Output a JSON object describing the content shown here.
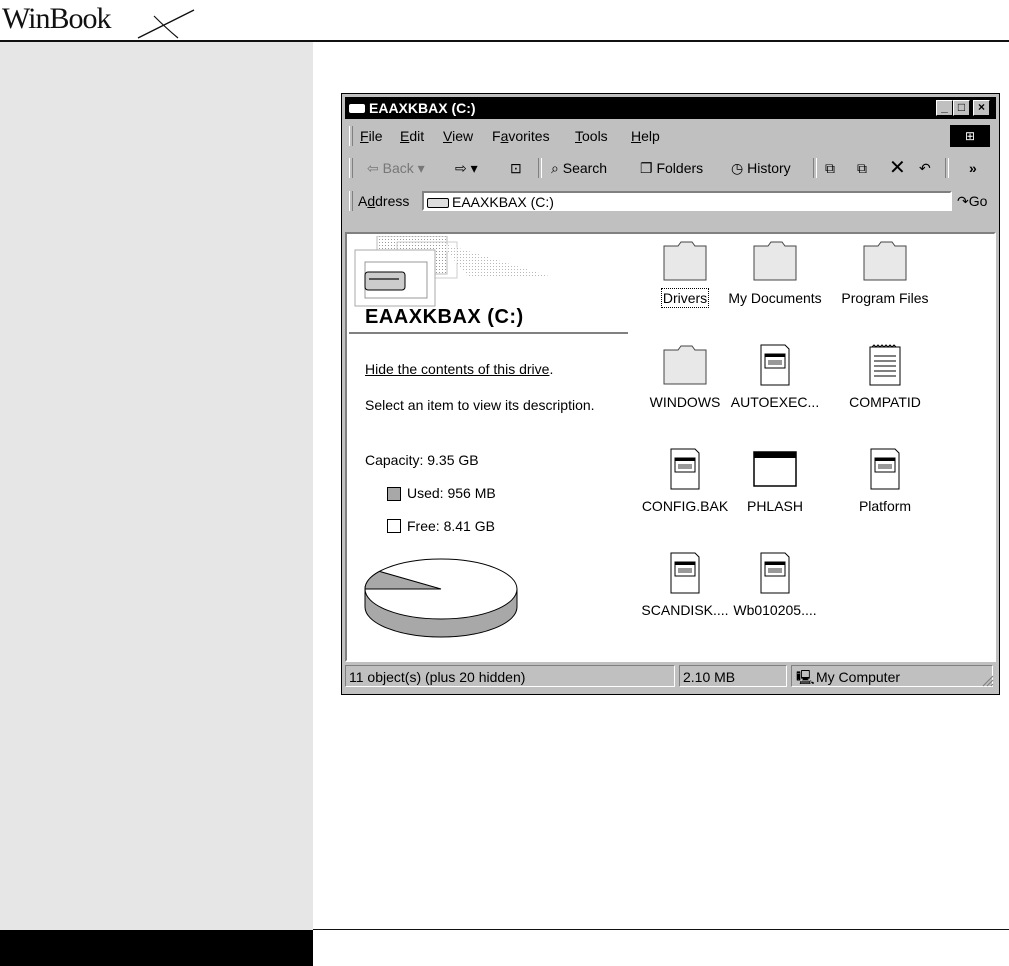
{
  "brand": {
    "name": "WinBook"
  },
  "window": {
    "title": "EAAXKBAX (C:)",
    "caption_buttons": {
      "minimize": "_",
      "maximize": "□",
      "close": "×"
    }
  },
  "menu": {
    "items": [
      {
        "key": "F",
        "rest": "ile"
      },
      {
        "key": "E",
        "rest": "dit"
      },
      {
        "key": "V",
        "rest": "iew"
      },
      {
        "pre": "F",
        "key": "a",
        "rest": "vorites"
      },
      {
        "key": "T",
        "rest": "ools"
      },
      {
        "key": "H",
        "rest": "elp"
      }
    ]
  },
  "toolbar": {
    "back": "Back",
    "search": "Search",
    "folders": "Folders",
    "history": "History",
    "more": "»"
  },
  "address": {
    "label": "Address",
    "label_key": "d",
    "value": "EAAXKBAX (C:)",
    "go": "Go"
  },
  "drive_panel": {
    "title": "EAAXKBAX (C:)",
    "hide_link": "Hide the contents of this drive",
    "hide_suffix": ".",
    "hint": "Select an item to view its description.",
    "capacity": "Capacity: 9.35 GB",
    "used": "Used: 956 MB",
    "free": "Free: 8.41 GB",
    "used_fraction": 0.1,
    "colors": {
      "used": "#a8a8a8",
      "free": "#ffffff"
    }
  },
  "files": [
    {
      "name": "Drivers",
      "icon": "folder-icon"
    },
    {
      "name": "My Documents",
      "icon": "folder-icon"
    },
    {
      "name": "Program Files",
      "icon": "folder-icon"
    },
    {
      "name": "WINDOWS",
      "icon": "folder-icon"
    },
    {
      "name": "AUTOEXEC...",
      "icon": "system-file-icon"
    },
    {
      "name": "COMPATID",
      "icon": "notepad-icon"
    },
    {
      "name": "CONFIG.BAK",
      "icon": "system-file-icon"
    },
    {
      "name": "PHLASH",
      "icon": "application-icon"
    },
    {
      "name": "Platform",
      "icon": "system-file-icon"
    },
    {
      "name": "SCANDISK....",
      "icon": "system-file-icon"
    },
    {
      "name": "Wb010205....",
      "icon": "system-file-icon"
    }
  ],
  "status": {
    "objects": "11 object(s) (plus 20 hidden)",
    "size": "2.10 MB",
    "zone": "My Computer"
  }
}
